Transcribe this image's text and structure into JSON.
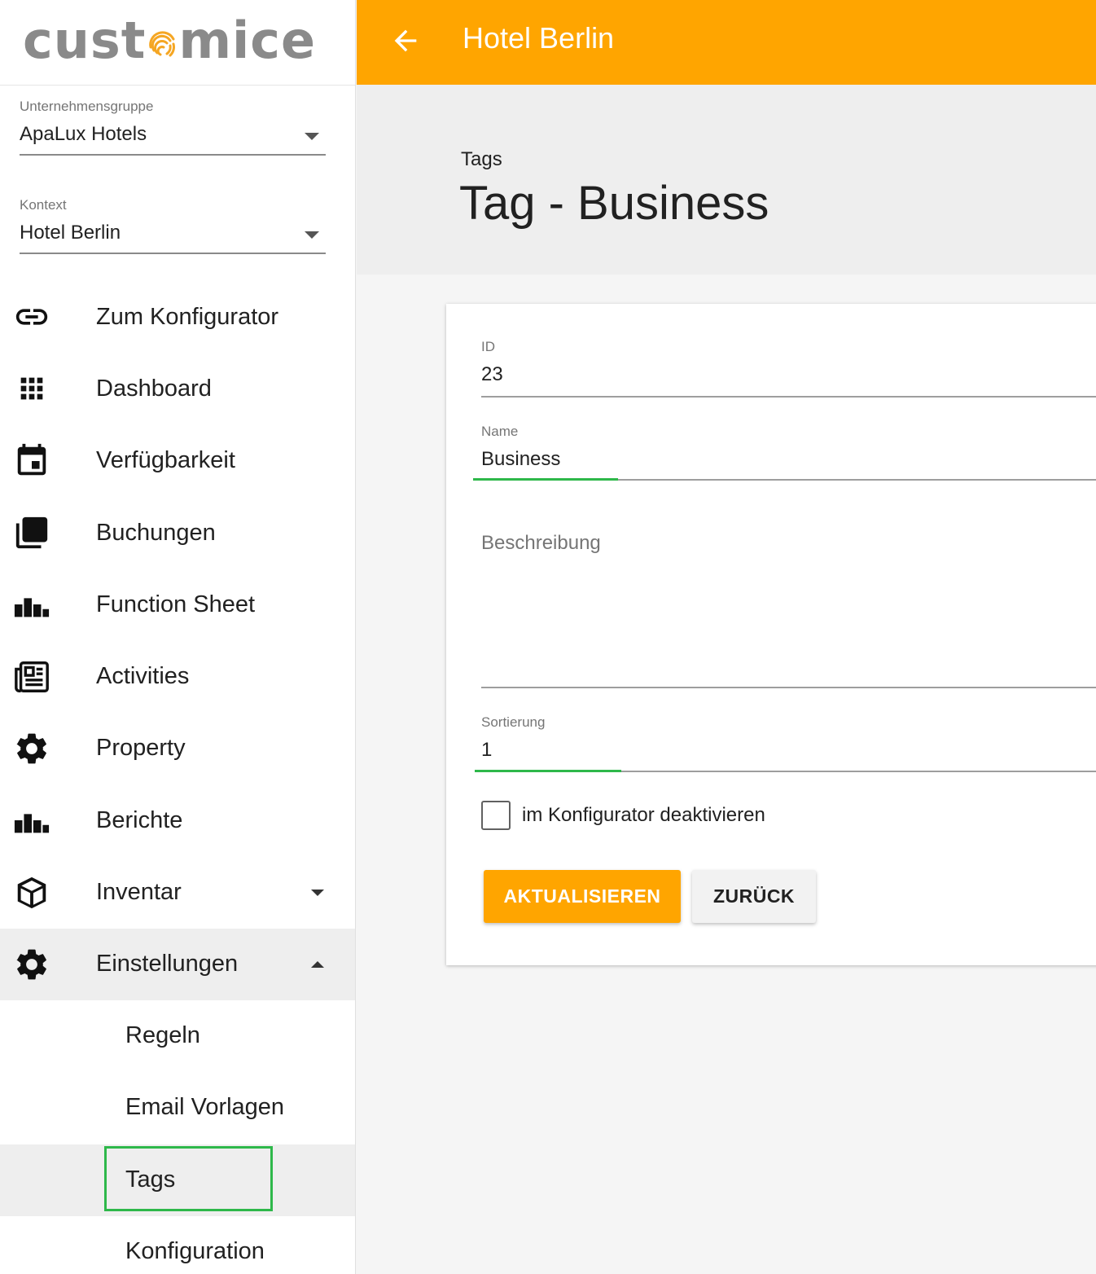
{
  "logo": {
    "part1": "cust",
    "part2": "mice",
    "colors": {
      "text": "#8a8a8a",
      "swirl": "#f5a623"
    }
  },
  "sidebar": {
    "company_group": {
      "label": "Unternehmensgruppe",
      "value": "ApaLux Hotels"
    },
    "context": {
      "label": "Kontext",
      "value": "Hotel Berlin"
    },
    "nav": [
      {
        "label": "Zum Konfigurator",
        "icon": "link-icon"
      },
      {
        "label": "Dashboard",
        "icon": "grid-icon"
      },
      {
        "label": "Verfügbarkeit",
        "icon": "calendar-icon"
      },
      {
        "label": "Buchungen",
        "icon": "layers-icon"
      },
      {
        "label": "Function Sheet",
        "icon": "bar-chart-icon"
      },
      {
        "label": "Activities",
        "icon": "newspaper-icon"
      },
      {
        "label": "Property",
        "icon": "gear-icon"
      },
      {
        "label": "Berichte",
        "icon": "bar-chart-icon"
      },
      {
        "label": "Inventar",
        "icon": "cube-icon",
        "expanded": false
      },
      {
        "label": "Einstellungen",
        "icon": "gear-icon",
        "expanded": true,
        "active": true
      }
    ],
    "sub_nav": [
      {
        "label": "Regeln"
      },
      {
        "label": "Email Vorlagen"
      },
      {
        "label": "Tags",
        "active": true
      },
      {
        "label": "Konfiguration"
      }
    ]
  },
  "header": {
    "title": "Hotel Berlin",
    "back_icon": "arrow-left-icon"
  },
  "page": {
    "breadcrumb": "Tags",
    "title": "Tag - Business"
  },
  "form": {
    "id": {
      "label": "ID",
      "value": "23"
    },
    "name": {
      "label": "Name",
      "value": "Business"
    },
    "description": {
      "placeholder": "Beschreibung",
      "value": ""
    },
    "sort": {
      "label": "Sortierung",
      "value": "1"
    },
    "deactivate": {
      "label": "im Konfigurator deaktivieren",
      "checked": false
    },
    "update_button": "AKTUALISIEREN",
    "back_button": "ZURÜCK"
  },
  "colors": {
    "accent": "#ffa500",
    "focus": "#2eb84a"
  }
}
